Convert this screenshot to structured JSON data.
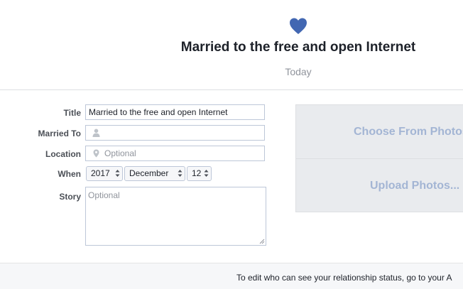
{
  "header": {
    "icon": "heart-icon",
    "icon_color": "#4267b2",
    "title": "Married to the free and open Internet",
    "date": "Today"
  },
  "form": {
    "title_label": "Title",
    "title_value": "Married to the free and open Internet",
    "married_to_label": "Married To",
    "married_to_value": "",
    "married_to_icon": "person-icon",
    "location_label": "Location",
    "location_placeholder": "Optional",
    "location_icon": "location-pin-icon",
    "when_label": "When",
    "year": "2017",
    "month": "December",
    "day": "12",
    "story_label": "Story",
    "story_placeholder": "Optional"
  },
  "photos": {
    "choose_label": "Choose From Photos",
    "upload_label": "Upload Photos..."
  },
  "footer": {
    "text": "To edit who can see your relationship status, go to your A"
  }
}
